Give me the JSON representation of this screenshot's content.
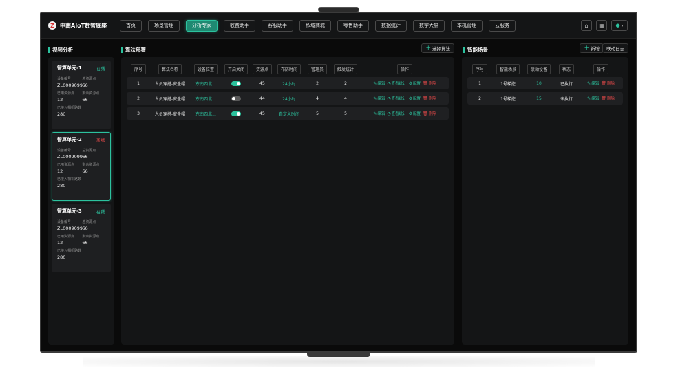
{
  "app": {
    "title": "中南AIoT数智底座"
  },
  "nav": [
    {
      "label": "首页",
      "active": false
    },
    {
      "label": "场景管理",
      "active": false
    },
    {
      "label": "分析专家",
      "active": true
    },
    {
      "label": "收费助手",
      "active": false
    },
    {
      "label": "客服助手",
      "active": false
    },
    {
      "label": "私域商城",
      "active": false
    },
    {
      "label": "零售助手",
      "active": false
    },
    {
      "label": "数据统计",
      "active": false
    },
    {
      "label": "数字大屏",
      "active": false
    },
    {
      "label": "本机管理",
      "active": false
    },
    {
      "label": "云服务",
      "active": false
    }
  ],
  "left": {
    "title": "视频分析",
    "units": [
      {
        "name": "智算单元-1",
        "status": "在线",
        "online": true,
        "device_label": "设备编号",
        "device_value": "ZL0009099",
        "total_label": "总资源点",
        "total_value": "66",
        "used_label": "已用资源点",
        "used_value": "12",
        "remain_label": "剩余资源点",
        "remain_value": "66",
        "cams_label": "已接入相机路数",
        "cams_value": "280"
      },
      {
        "name": "智算单元-2",
        "status": "离线",
        "online": false,
        "device_label": "设备编号",
        "device_value": "ZL0009099",
        "total_label": "总资源点",
        "total_value": "66",
        "used_label": "已用资源点",
        "used_value": "12",
        "remain_label": "剩余资源点",
        "remain_value": "66",
        "cams_label": "已接入相机路数",
        "cams_value": "280"
      },
      {
        "name": "智算单元-3",
        "status": "在线",
        "online": true,
        "device_label": "设备编号",
        "device_value": "ZL0009099",
        "total_label": "总资源点",
        "total_value": "66",
        "used_label": "已用资源点",
        "used_value": "12",
        "remain_label": "剩余资源点",
        "remain_value": "66",
        "cams_label": "已接入相机路数",
        "cams_value": "280"
      }
    ]
  },
  "algo": {
    "title": "算法部署",
    "select_label": "选择算法",
    "headers": [
      "序号",
      "算法名称",
      "设备位置",
      "开启关闭",
      "资源点",
      "布防时间",
      "管理员",
      "触发统计",
      "操作"
    ],
    "rows": [
      {
        "idx": "1",
        "name": "人员穿搭-安全帽",
        "location": "东南西北...",
        "enabled": true,
        "points": "45",
        "time": "24小时",
        "admins": "2",
        "triggers": "2"
      },
      {
        "idx": "2",
        "name": "人员穿搭-安全帽",
        "location": "东南西北...",
        "enabled": false,
        "points": "44",
        "time": "24小时",
        "admins": "4",
        "triggers": "4"
      },
      {
        "idx": "3",
        "name": "人员穿搭-安全帽",
        "location": "东南西北...",
        "enabled": true,
        "points": "45",
        "time": "自定义时间",
        "admins": "5",
        "triggers": "5"
      }
    ],
    "ops": {
      "edit": "编辑",
      "view": "查看统计",
      "config": "配置",
      "delete": "删除"
    }
  },
  "scene": {
    "title": "智能场景",
    "add_label": "新增",
    "log_label": "联动日志",
    "headers": [
      "序号",
      "智能场景",
      "联动设备",
      "状态",
      "操作"
    ],
    "rows": [
      {
        "idx": "1",
        "name": "1号梯控",
        "devices": "10",
        "state": "已执行"
      },
      {
        "idx": "2",
        "name": "1号梯控",
        "devices": "15",
        "state": "未执行"
      }
    ],
    "ops": {
      "edit": "编辑",
      "delete": "删除"
    }
  },
  "colors": {
    "accent": "#2cc29e",
    "danger": "#e04848",
    "background": "#0a0a0a",
    "panel": "#141516"
  }
}
